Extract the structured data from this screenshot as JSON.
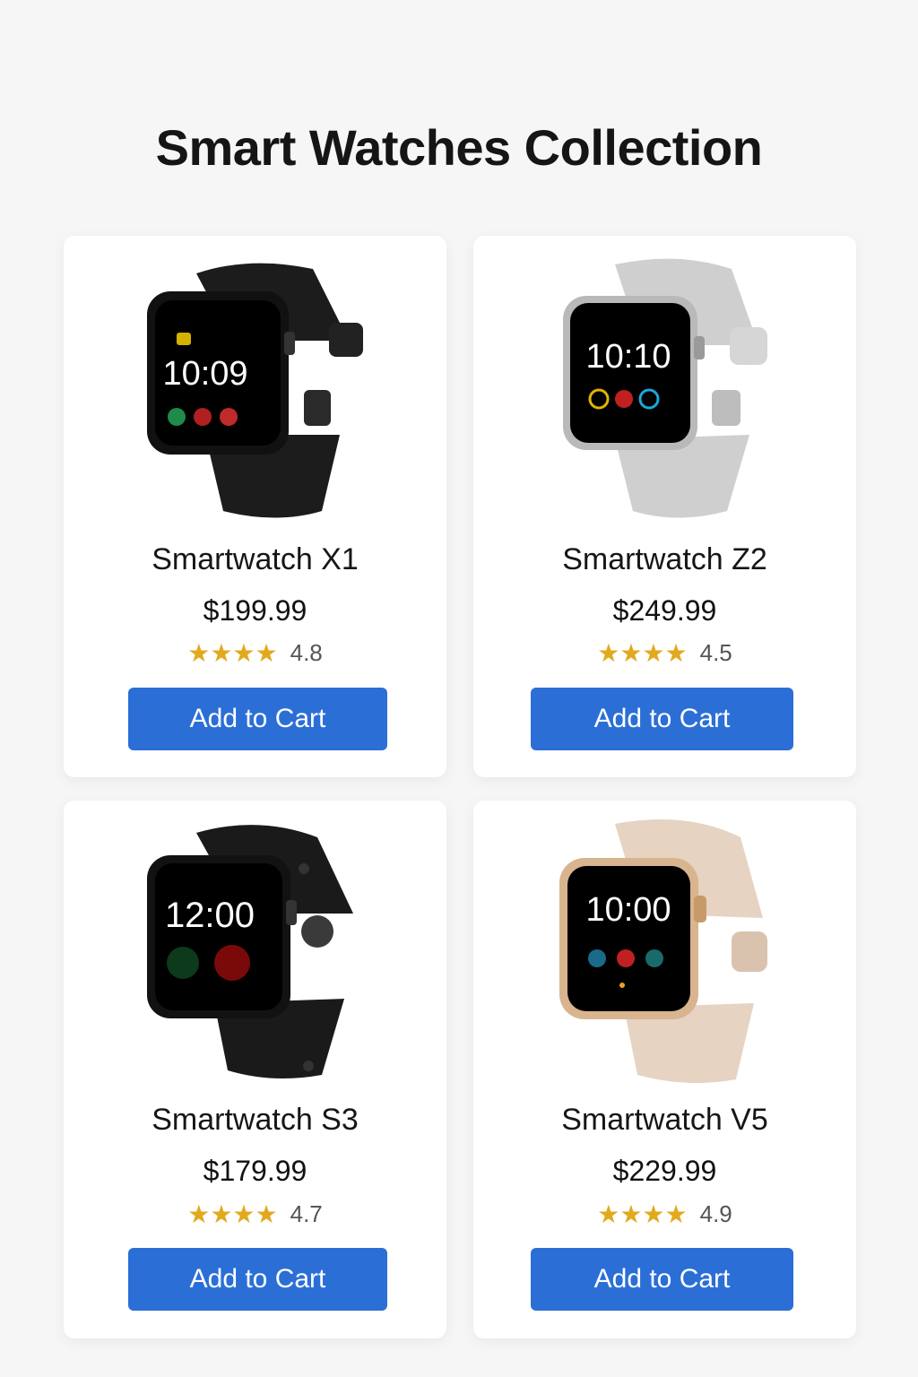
{
  "page": {
    "title": "Smart Watches Collection"
  },
  "products": [
    {
      "name": "Smartwatch X1",
      "price": "$199.99",
      "rating": "4.8",
      "stars": "★★★★",
      "button_label": "Add to Cart",
      "image": {
        "icon": "watch-black-icon",
        "screen_time": "10:09",
        "band_color": "#1c1c1c",
        "case_color": "#111111"
      }
    },
    {
      "name": "Smartwatch Z2",
      "price": "$249.99",
      "rating": "4.5",
      "stars": "★★★★",
      "button_label": "Add to Cart",
      "image": {
        "icon": "watch-silver-icon",
        "screen_time": "10:10",
        "band_color": "#cfcfcf",
        "case_color": "#b9b9b9"
      }
    },
    {
      "name": "Smartwatch S3",
      "price": "$179.99",
      "rating": "4.7",
      "stars": "★★★★",
      "button_label": "Add to Cart",
      "image": {
        "icon": "watch-black-sport-icon",
        "screen_time": "12:00",
        "band_color": "#1a1a1a",
        "case_color": "#121212"
      }
    },
    {
      "name": "Smartwatch V5",
      "price": "$229.99",
      "rating": "4.9",
      "stars": "★★★★",
      "button_label": "Add to Cart",
      "image": {
        "icon": "watch-rose-gold-icon",
        "screen_time": "10:00",
        "band_color": "#e6d3c2",
        "case_color": "#d8b48f"
      }
    }
  ],
  "colors": {
    "accent": "#2b6fd6",
    "star": "#e2a91d",
    "background": "#f6f6f6"
  }
}
